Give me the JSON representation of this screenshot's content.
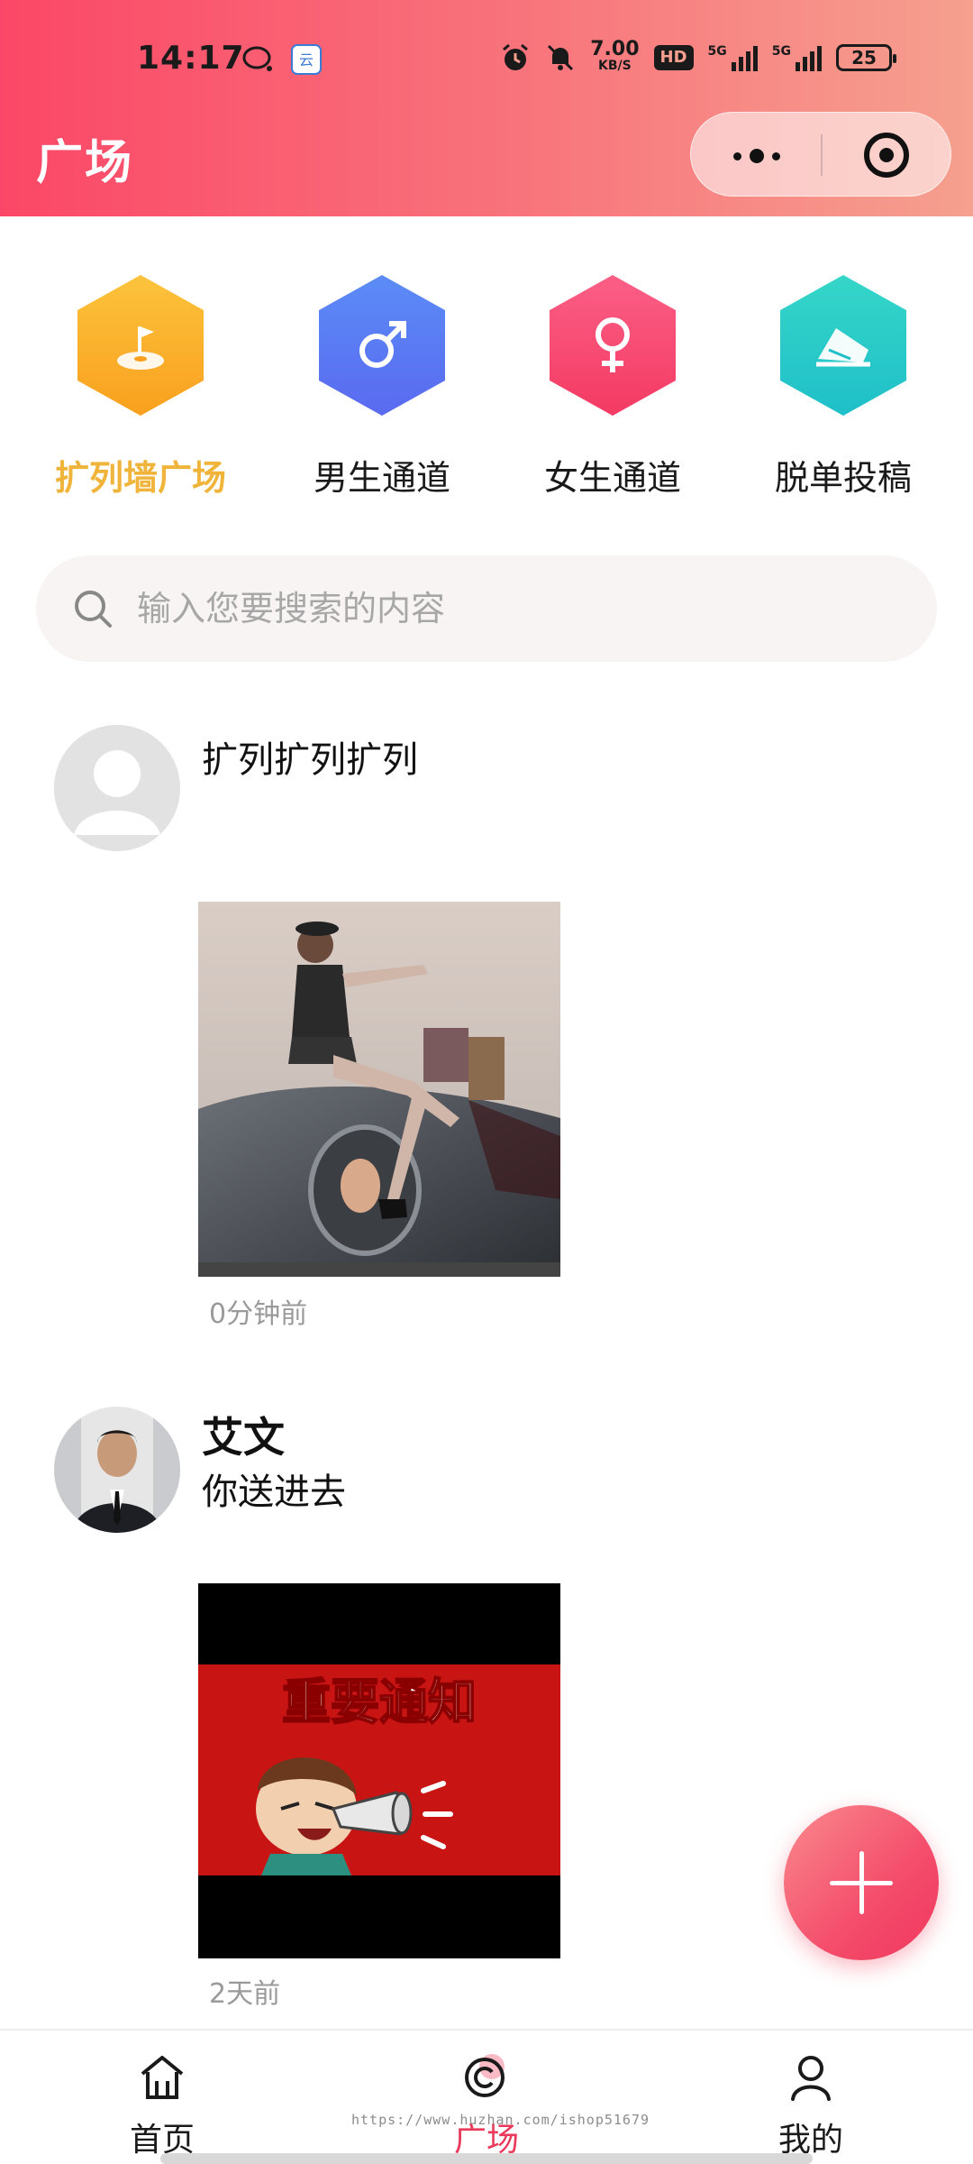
{
  "status_bar": {
    "time": "14:17",
    "net_speed_value": "7.00",
    "net_speed_unit": "KB/S",
    "hd_badge": "HD",
    "signal1_label": "5G",
    "signal2_label": "5G",
    "battery": "25"
  },
  "header": {
    "title": "广场"
  },
  "categories": [
    {
      "label": "扩列墙广场",
      "icon": "flag-icon",
      "active": true
    },
    {
      "label": "男生通道",
      "icon": "male-icon"
    },
    {
      "label": "女生通道",
      "icon": "female-icon"
    },
    {
      "label": "脱单投稿",
      "icon": "envelope-icon"
    }
  ],
  "search": {
    "placeholder": "输入您要搜索的内容"
  },
  "posts": [
    {
      "name": "扩列扩列扩列",
      "text": "",
      "time": "0分钟前"
    },
    {
      "name": "艾文",
      "text": "你送进去",
      "time": "2天前",
      "image_text": "重要通知"
    }
  ],
  "tabbar": {
    "items": [
      {
        "label": "首页",
        "icon": "home-icon"
      },
      {
        "label": "广场",
        "icon": "square-icon",
        "active": true
      },
      {
        "label": "我的",
        "icon": "user-icon"
      }
    ],
    "watermark": "https://www.huzhan.com/ishop51679"
  },
  "colors": {
    "accent": "#f44d6b",
    "active_category": "#f0b43a"
  }
}
